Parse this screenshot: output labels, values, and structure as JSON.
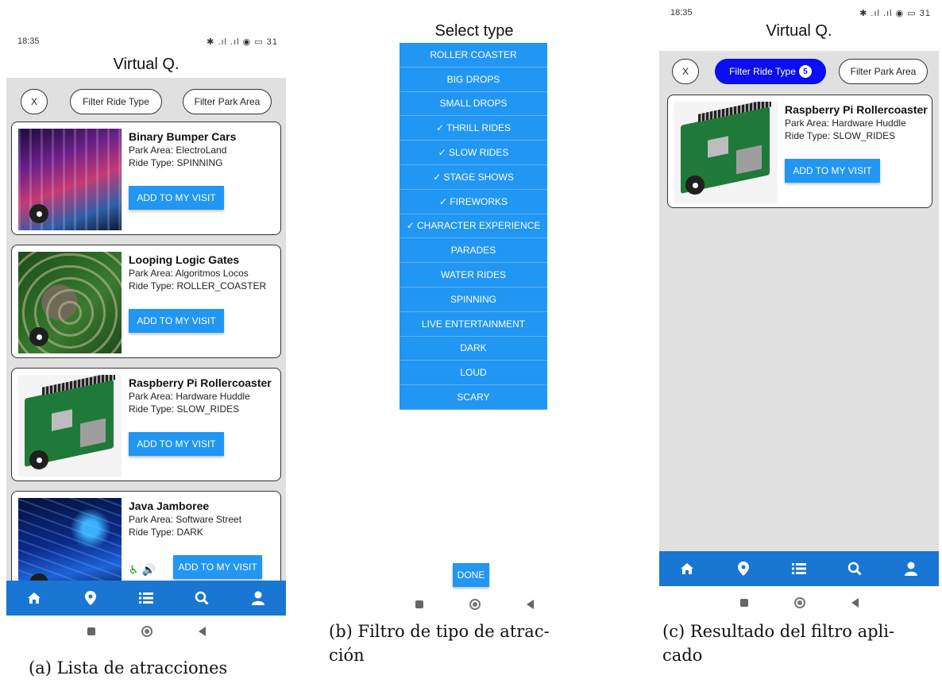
{
  "status_bar": {
    "time": "18:35",
    "icons_text": "✱ .ıl .ıl ◉ ▭ 31"
  },
  "app": {
    "title": "Virtual Q."
  },
  "filters": {
    "clear_label": "X",
    "ride_type_label": "Filter Ride Type",
    "park_area_label": "Filter Park Area",
    "active_count": "5"
  },
  "rides": [
    {
      "name": "Binary Bumper Cars",
      "park_area": "Park Area: ElectroLand",
      "ride_type": "Ride Type: SPINNING"
    },
    {
      "name": "Looping Logic Gates",
      "park_area": "Park Area: Algoritmos Locos",
      "ride_type": "Ride Type: ROLLER_COASTER"
    },
    {
      "name": "Raspberry Pi Rollercoaster",
      "park_area": "Park Area: Hardware Huddle",
      "ride_type": "Ride Type: SLOW_RIDES"
    },
    {
      "name": "Java Jamboree",
      "park_area": "Park Area: Software Street",
      "ride_type": "Ride Type: DARK"
    }
  ],
  "add_button_label": "ADD TO MY VISIT",
  "accessibility_icons": "♿ 🔊",
  "select_type": {
    "title": "Select type",
    "options": [
      "ROLLER COASTER",
      "BIG DROPS",
      "SMALL DROPS",
      "✓ THRILL RIDES",
      "✓ SLOW RIDES",
      "✓ STAGE SHOWS",
      "✓ FIREWORKS",
      "✓ CHARACTER EXPERIENCE",
      "PARADES",
      "WATER RIDES",
      "SPINNING",
      "LIVE ENTERTAINMENT",
      "DARK",
      "LOUD",
      "SCARY"
    ],
    "done_label": "DONE"
  },
  "nav_icons": [
    "home-icon",
    "map-pin-icon",
    "list-icon",
    "search-icon",
    "user-icon"
  ],
  "colors": {
    "accent": "#2196f3",
    "nav_bar": "#1976d2",
    "active_chip": "#0a0ef0",
    "accessibility": "#1a9c1a"
  },
  "captions": {
    "a": "(a) Lista de atracciones",
    "b_line1": "(b) Filtro de tipo de atrac-",
    "b_line2": "ción",
    "c_line1": "(c) Resultado del filtro apli-",
    "c_line2": "cado"
  }
}
